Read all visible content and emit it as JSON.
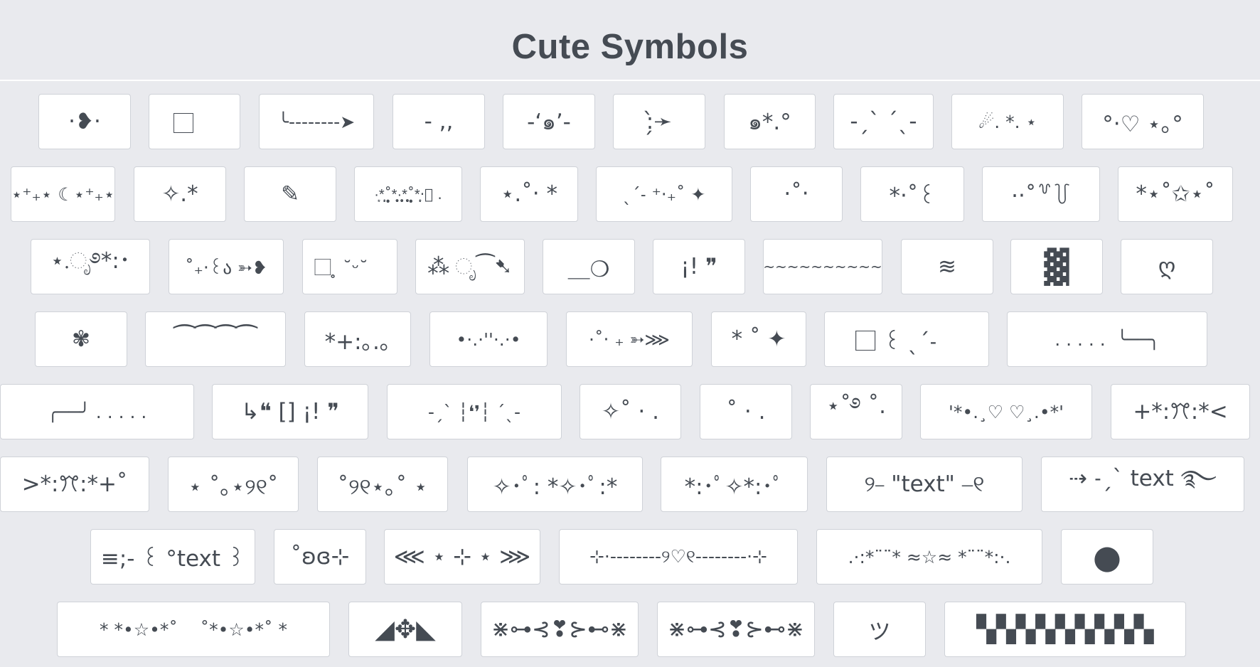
{
  "page": {
    "title": "Cute Symbols"
  },
  "rows": [
    [
      "·❥·",
      "⃞",
      "╰--------➤",
      "- ,,",
      "-‘๑’-",
      ":̗̀➛",
      "๑*.°",
      "-ˏˋ ˊˎ-",
      "☄. *. ⋆",
      "°‧♡ ⋆｡°"
    ],
    [
      "⋆⁺₊⋆ ☾⋆⁺₊⋆",
      "✧.*",
      "✎",
      "·͙*̩̩͙˚̩̥̩̥*̩̩̥͙·̩̩̥͙*̩̩̥͙˚̩̥̩̥*̩̩͙‧͙ .",
      "⋆.˚‧ *",
      "ˎˊ˗ ⁺‧₊˚ ✦",
      "·˚‧",
      "*‧˚꒰",
      "·‧˚꒷꒦",
      "*⋆˚✩⋆˚"
    ],
    [
      "⋆.ೃ࿔*:･",
      "˚₊‧꒰ა ➳❥",
      "⃞ ̥ ˘ᵕ˘",
      "⁂ ೃ⁀➷",
      "＿❍",
      "¡! ❞",
      "~~~~~~~~~~",
      "≋",
      "▓",
      "ღ"
    ],
    [
      "✾",
      "⁀⁀⁀⁀",
      "*+:｡.｡",
      "•·.·''·.·•",
      "·˚‧ ₊ ➳⋙",
      "* ˚ ✦",
      "⃞⃞ ꒰ ˎˊ˗",
      ". . . . .  ╰──╮",
      ""
    ],
    [
      "╭──╯ . . . . .",
      "↳❝ [] ¡! ❞",
      "-ˏˋ ┆❛❜┆ ˊˎ-",
      "✧˚ · .",
      "˚ · .",
      "⋆˚࿔ ˚.",
      "'*•.¸♡ ♡¸.•*'",
      "+*:ꔫ:*<",
      ""
    ],
    [
      ">*:ꔫ:*+˚",
      "⋆ ˚｡⋆୨୧˚",
      "˚୨୧⋆｡˚ ⋆",
      "✧･ﾟ: *✧･ﾟ:*",
      "*:･ﾟ✧*:･ﾟ",
      "୨⎯ \"text\" ⎯୧",
      "⇢ ˗ˏˋ text ࿐",
      ""
    ],
    [
      "≡;- ꒰ °text ꒱",
      "˚ʚɞ⊹",
      "⋘ ⋆ ⊹ ⋆ ⋙",
      "⊹·--------୨♡୧--------·⊹",
      ".·:*¨¨* ≈☆≈ *¨¨*:·.",
      "●",
      ""
    ],
    [
      "* *•☆•*˚    ˚*•☆•*˚ *",
      "◢✥◣",
      "⋇⊶⊰❣⊱⊷⋇",
      "⋇⊶⊰❣⊱⊷⋇",
      "ツ",
      "▚▚▚▚▚▚▚▚▚",
      ""
    ]
  ]
}
